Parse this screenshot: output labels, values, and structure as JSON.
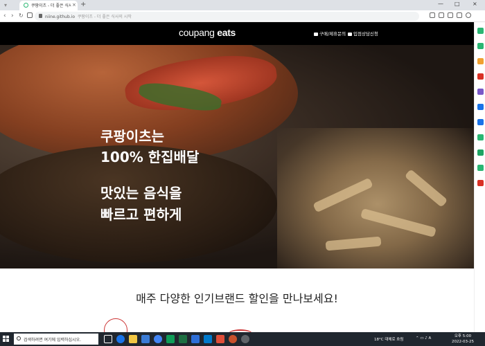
{
  "browser": {
    "tab_title": "쿠팡이츠 - 더 좋은 식사의 시작",
    "tab_close": "×",
    "new_tab": "+",
    "url_host": "niine.github.io",
    "url_page_title": "쿠팡이츠 - 더 좋은 식사의 시작",
    "nav_back": "‹",
    "nav_forward": "›",
    "nav_reload": "↻",
    "win_min": "—",
    "win_max": "□",
    "win_close": "×"
  },
  "site": {
    "logo_main": "coupang",
    "logo_sub": "eats",
    "header_links": [
      "구매/제휴문의",
      "입점상담신청"
    ],
    "hero_line1": "쿠팡이츠는",
    "hero_line2": "100% 한집배달",
    "hero_line3": "맛있는 음식을",
    "hero_line4": "빠르고 편하게",
    "headline": "매주 다양한 인기브랜드 할인을 만나보세요!"
  },
  "taskbar": {
    "search_placeholder": "검색하려면 여기에 입력하십시오.",
    "weather": "18°C  대체로 흐림",
    "time": "오후 5:00",
    "date": "2022-03-25"
  },
  "colors": {
    "header_bg": "#000000",
    "taskbar_bg": "#20272f",
    "tab_bar_bg": "#dee1e6",
    "brand_red": "#cc3333"
  }
}
